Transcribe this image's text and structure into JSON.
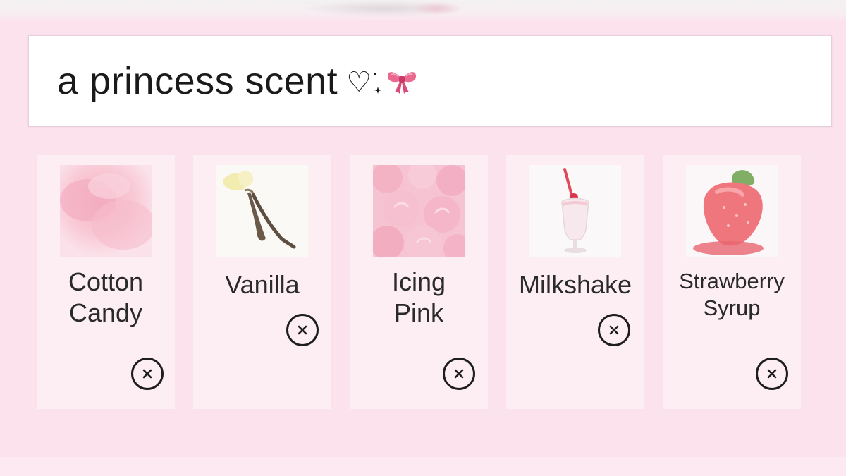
{
  "search": {
    "value": "a princess scent",
    "decoration_icons": [
      "heart-outline-icon",
      "sparkle-icon",
      "pink-bow-icon"
    ]
  },
  "colors": {
    "background": "#fbe2ed",
    "card": "#fdeef4",
    "text": "#1a1a1a",
    "bow": "#e0557f"
  },
  "scents": [
    {
      "label_lines": [
        "Cotton",
        "Candy"
      ],
      "thumbnail": "cotton-candy-image"
    },
    {
      "label_lines": [
        "Vanilla"
      ],
      "thumbnail": "vanilla-flower-image"
    },
    {
      "label_lines": [
        "Icing",
        "Pink"
      ],
      "thumbnail": "pink-frosting-image"
    },
    {
      "label_lines": [
        "Milkshake"
      ],
      "thumbnail": "milkshake-glass-image"
    },
    {
      "label_lines": [
        "Strawberry",
        "Syrup"
      ],
      "thumbnail": "strawberry-image"
    }
  ],
  "remove_icon": "close-circle-icon"
}
